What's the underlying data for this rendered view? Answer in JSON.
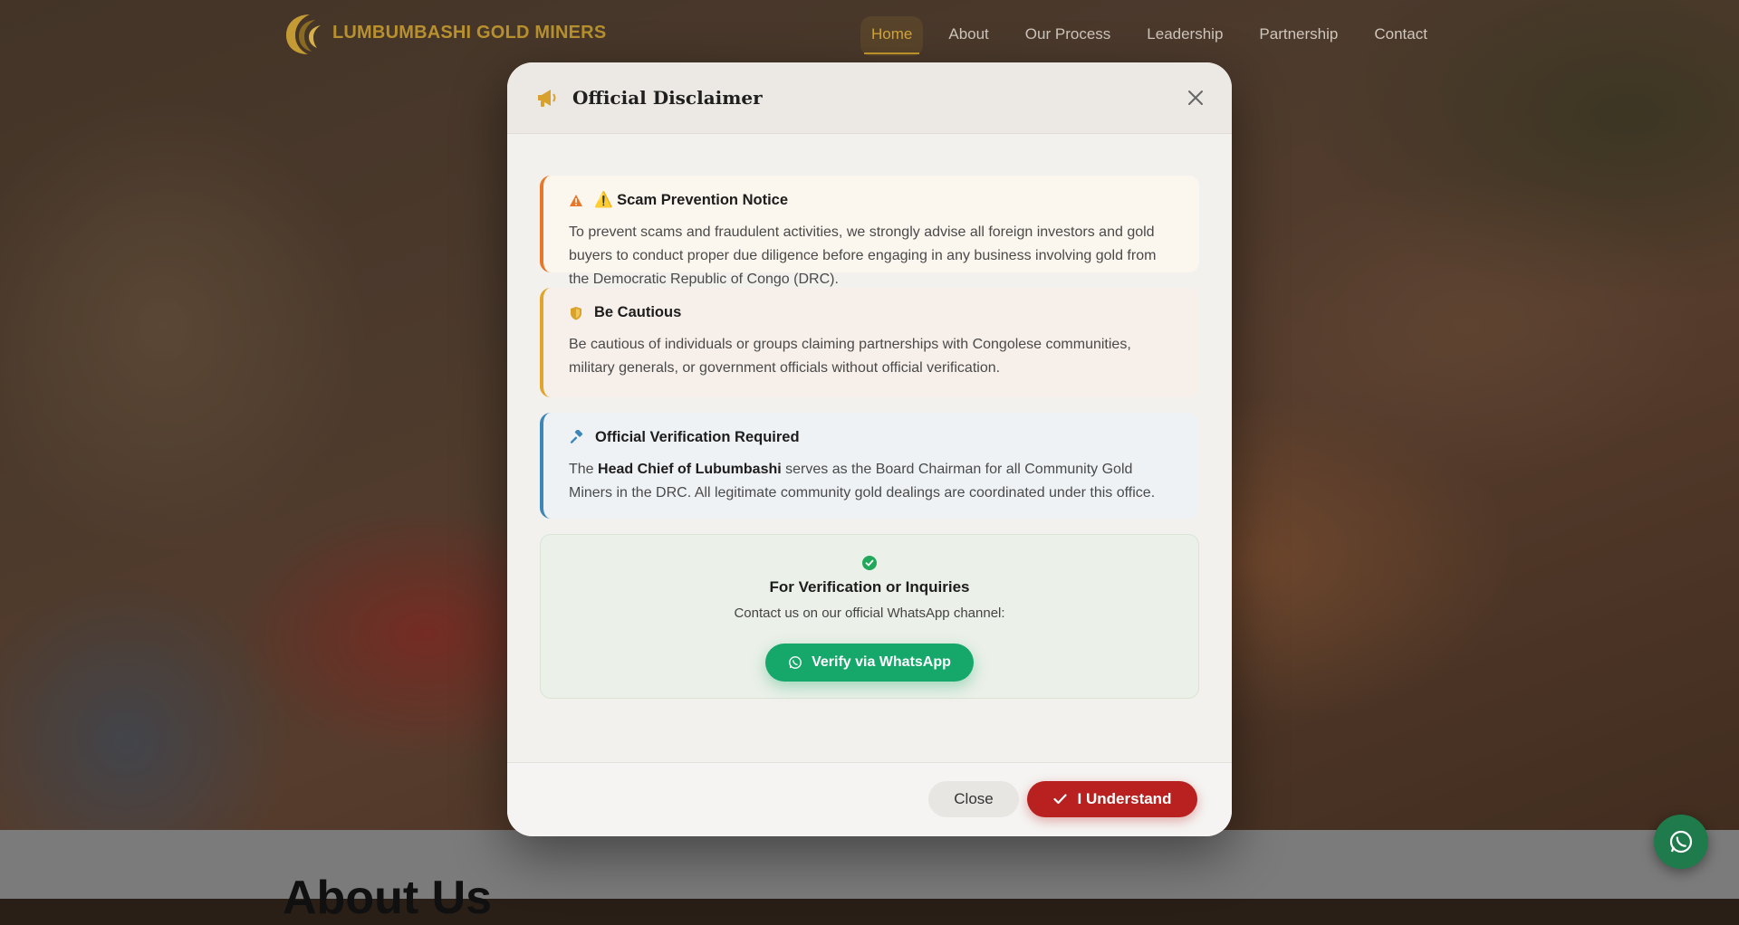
{
  "nav": {
    "brand": "LUMBUMBASHI GOLD MINERS",
    "links": [
      "Home",
      "About",
      "Our Process",
      "Leadership",
      "Partnership",
      "Contact"
    ],
    "active": "Home"
  },
  "section": {
    "title": "About Us"
  },
  "modal": {
    "title": "Official Disclaimer",
    "notices": [
      {
        "heading": "⚠️ Scam Prevention Notice",
        "text": "To prevent scams and fraudulent activities, we strongly advise all foreign investors and gold buyers to conduct proper due diligence before engaging in any business involving gold from the Democratic Republic of Congo (DRC)."
      },
      {
        "heading": "Be Cautious",
        "text": "Be cautious of individuals or groups claiming partnerships with Congolese communities, military generals, or government officials without official verification."
      },
      {
        "heading": "Official Verification Required",
        "text_pre": "The ",
        "text_bold": "Head Chief of Lubumbashi",
        "text_post": " serves as the Board Chairman for all Community Gold Miners in the DRC. All legitimate community gold dealings are coordinated under this office."
      }
    ],
    "verify": {
      "title": "For Verification or Inquiries",
      "subtitle": "Contact us on our official WhatsApp channel:",
      "button": "Verify via WhatsApp"
    },
    "footer": {
      "close": "Close",
      "understand": "I Understand"
    }
  },
  "colors": {
    "accent_gold": "#b8912e",
    "danger_red": "#b8211f",
    "whatsapp_green": "#16a86a"
  }
}
